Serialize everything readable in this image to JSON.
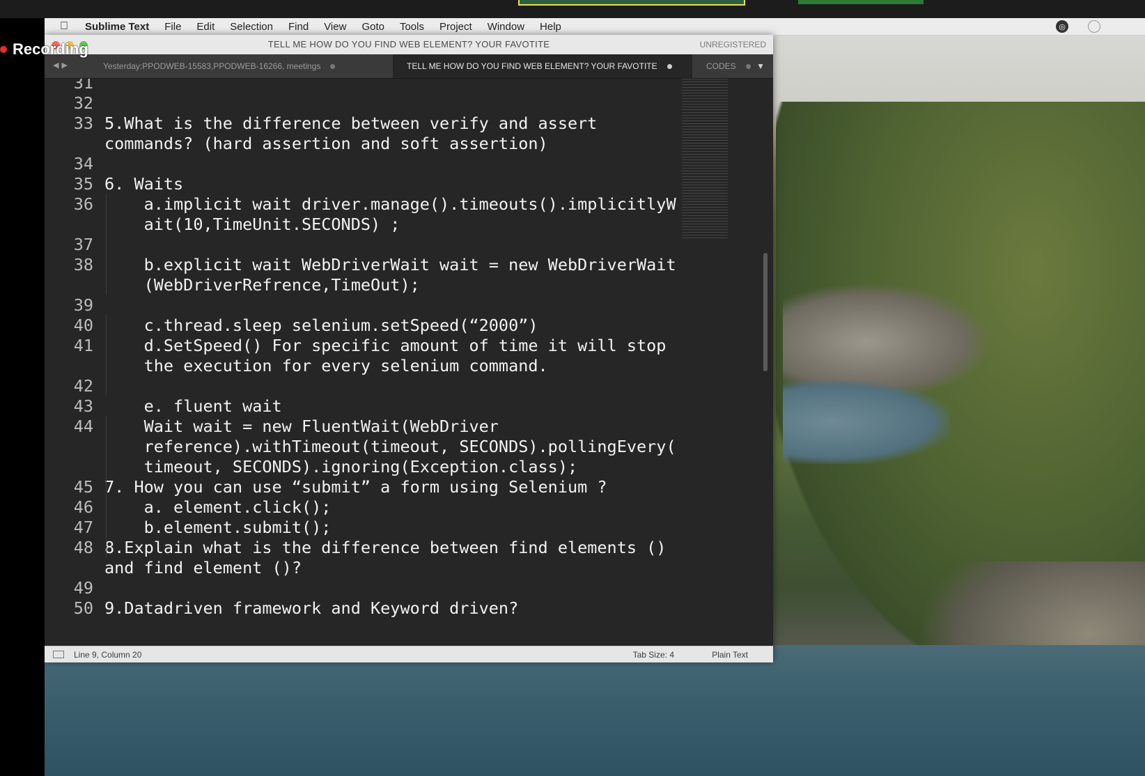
{
  "menubar": {
    "app_name": "Sublime Text",
    "items": [
      "File",
      "Edit",
      "Selection",
      "Find",
      "View",
      "Goto",
      "Tools",
      "Project",
      "Window",
      "Help"
    ]
  },
  "overlay": {
    "recording_label": "Recording"
  },
  "window": {
    "title": "TELL ME HOW DO YOU FIND WEB ELEMENT? YOUR FAVOTITE",
    "registration": "UNREGISTERED"
  },
  "tabs": [
    {
      "label": "Yesterday:PPODWEB-15583,PPODWEB-16266, meetings",
      "active": false
    },
    {
      "label": "TELL ME HOW DO YOU FIND WEB ELEMENT? YOUR FAVOTITE",
      "active": true
    },
    {
      "label": "CODES",
      "active": false
    }
  ],
  "editor_lines": [
    {
      "num": "31",
      "text": ""
    },
    {
      "num": "32",
      "text": ""
    },
    {
      "num": "33",
      "text": "5.What is the difference between verify and assert"
    },
    {
      "num": "",
      "text": "commands? (hard assertion and soft assertion)"
    },
    {
      "num": "34",
      "text": ""
    },
    {
      "num": "35",
      "text": "6. Waits"
    },
    {
      "num": "36",
      "text": "    a.implicit wait driver.manage().timeouts().implicitlyW"
    },
    {
      "num": "",
      "text": "    ait(10,TimeUnit.SECONDS) ;"
    },
    {
      "num": "37",
      "text": ""
    },
    {
      "num": "38",
      "text": "    b.explicit wait WebDriverWait wait = new WebDriverWait"
    },
    {
      "num": "",
      "text": "    (WebDriverRefrence,TimeOut);"
    },
    {
      "num": "39",
      "text": ""
    },
    {
      "num": "40",
      "text": "    c.thread.sleep selenium.setSpeed(“2000”)"
    },
    {
      "num": "41",
      "text": "    d.SetSpeed() For specific amount of time it will stop"
    },
    {
      "num": "",
      "text": "    the execution for every selenium command."
    },
    {
      "num": "42",
      "text": ""
    },
    {
      "num": "43",
      "text": "    e. fluent wait"
    },
    {
      "num": "44",
      "text": "    Wait wait = new FluentWait(WebDriver"
    },
    {
      "num": "",
      "text": "    reference).withTimeout(timeout, SECONDS).pollingEvery("
    },
    {
      "num": "",
      "text": "    timeout, SECONDS).ignoring(Exception.class);"
    },
    {
      "num": "45",
      "text": "7. How you can use “submit” a form using Selenium ?"
    },
    {
      "num": "46",
      "text": "    a. element.click();"
    },
    {
      "num": "47",
      "text": "    b.element.submit();"
    },
    {
      "num": "48",
      "text": "8.Explain what is the difference between find elements ()"
    },
    {
      "num": "",
      "text": "and find element ()?"
    },
    {
      "num": "49",
      "text": ""
    },
    {
      "num": "50",
      "text": "9.Datadriven framework and Keyword driven?"
    }
  ],
  "statusbar": {
    "position": "Line 9, Column 20",
    "tab_size": "Tab Size: 4",
    "syntax": "Plain Text"
  }
}
